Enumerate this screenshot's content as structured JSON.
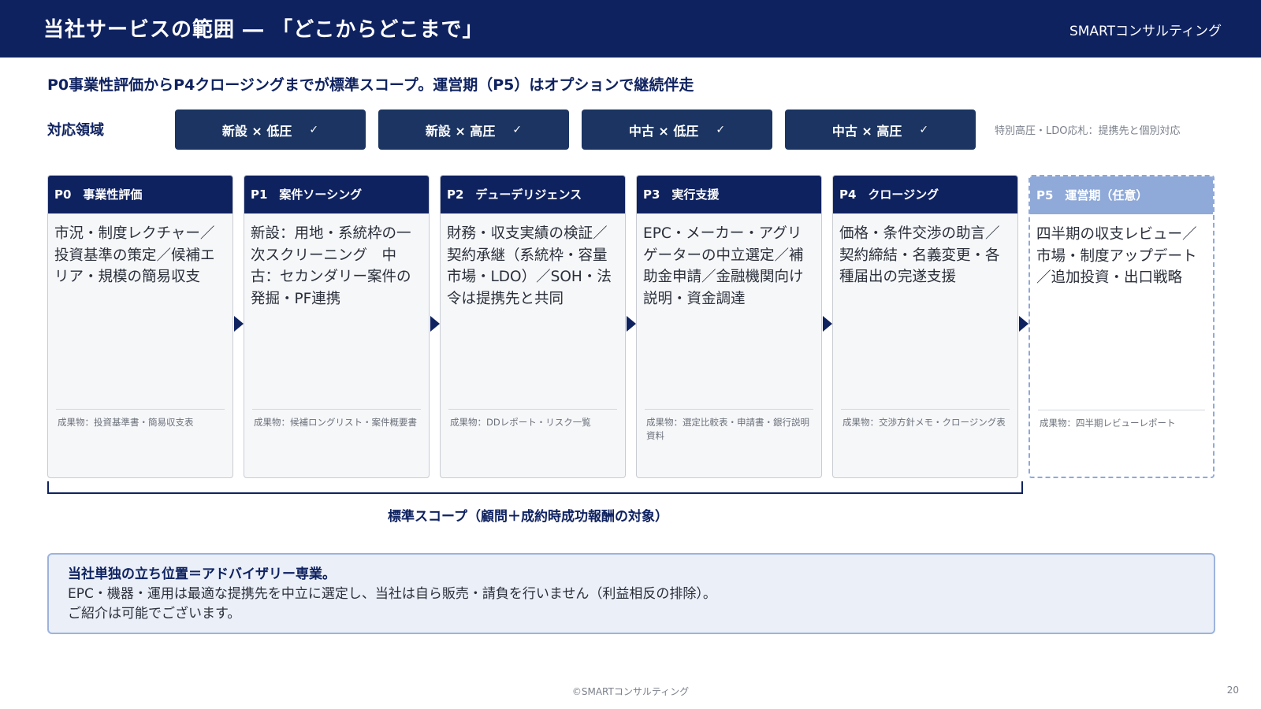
{
  "header": {
    "title": "当社サービスの範囲 ― 「どこからどこまで」",
    "brand": "SMARTコンサルティング"
  },
  "subtitle": "P0事業性評価からP4クロージングまでが標準スコープ。運営期（P5）はオプションで継続伴走",
  "coverage": {
    "label": "対応領域",
    "chips": [
      {
        "label": "新設 × 低圧",
        "check": "✓"
      },
      {
        "label": "新設 × 高圧",
        "check": "✓"
      },
      {
        "label": "中古 × 低圧",
        "check": "✓"
      },
      {
        "label": "中古 × 高圧",
        "check": "✓"
      }
    ],
    "note": "特別高圧・LDO応札：提携先と個別対応"
  },
  "phases": [
    {
      "head": "P0　事業性評価",
      "body": "市況・制度レクチャー／投資基準の策定／候補エリア・規模の簡易収支",
      "output": "成果物：投資基準書・簡易収支表"
    },
    {
      "head": "P1　案件ソーシング",
      "body": "新設：用地・系統枠の一次スクリーニング　中古：セカンダリー案件の発掘・PF連携",
      "output": "成果物：候補ロングリスト・案件概要書"
    },
    {
      "head": "P2　デューデリジェンス",
      "body": "財務・収支実績の検証／契約承継（系統枠・容量市場・LDO）／SOH・法令は提携先と共同",
      "output": "成果物：DDレポート・リスク一覧"
    },
    {
      "head": "P3　実行支援",
      "body": "EPC・メーカー・アグリゲーターの中立選定／補助金申請／金融機関向け説明・資金調達",
      "output": "成果物：選定比較表・申請書・銀行説明資料"
    },
    {
      "head": "P4　クロージング",
      "body": "価格・条件交渉の助言／契約締結・名義変更・各種届出の完遂支援",
      "output": "成果物：交渉方針メモ・クロージング表"
    },
    {
      "head": "P5　運営期（任意）",
      "body": "四半期の収支レビュー／市場・制度アップデート／追加投資・出口戦略",
      "output": "成果物：四半期レビューレポート"
    }
  ],
  "scope_label": "標準スコープ（顧問＋成約時成功報酬の対象）",
  "note": {
    "title": "当社単独の立ち位置＝アドバイザリー専業。",
    "line1": "EPC・機器・運用は最適な提携先を中立に選定し、当社は自ら販売・請負を行いません（利益相反の排除）。",
    "line2": "ご紹介は可能でございます。"
  },
  "footer": {
    "copyright": "©SMARTコンサルティング",
    "page": "20"
  }
}
